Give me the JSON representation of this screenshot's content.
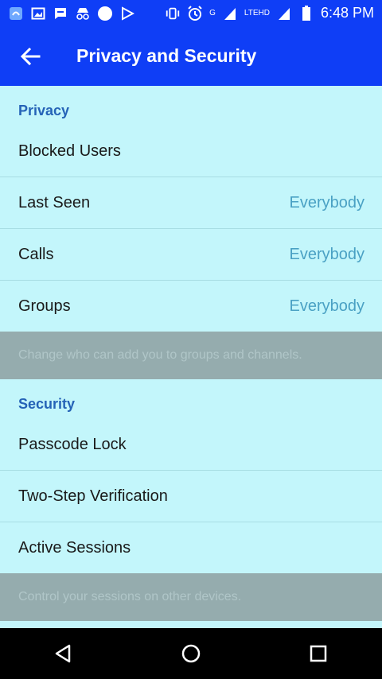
{
  "status_bar": {
    "time": "6:48 PM",
    "network_label": "G",
    "lte_label": "LTEHD",
    "icons": [
      "app-icon",
      "gallery-icon",
      "message-icon",
      "incognito-icon",
      "circle-icon",
      "play-store-icon",
      "vibrate-icon",
      "alarm-icon",
      "signal-icon",
      "signal-icon",
      "battery-icon"
    ]
  },
  "app_bar": {
    "title": "Privacy and Security",
    "back_icon": "back-arrow-icon"
  },
  "privacy": {
    "header": "Privacy",
    "items": [
      {
        "label": "Blocked Users",
        "value": ""
      },
      {
        "label": "Last Seen",
        "value": "Everybody"
      },
      {
        "label": "Calls",
        "value": "Everybody"
      },
      {
        "label": "Groups",
        "value": "Everybody"
      }
    ],
    "info": "Change who can add you to groups and channels."
  },
  "security": {
    "header": "Security",
    "items": [
      {
        "label": "Passcode Lock"
      },
      {
        "label": "Two-Step Verification"
      },
      {
        "label": "Active Sessions"
      }
    ],
    "info": "Control your sessions on other devices."
  },
  "nav_bar": {
    "icons": [
      "back-triangle-icon",
      "home-circle-icon",
      "recents-square-icon"
    ]
  },
  "colors": {
    "app_bar": "#0f3ef6",
    "background": "#c3f6fb",
    "section_header": "#2563b7",
    "value": "#4aa1c4",
    "info_bg": "#95acae"
  }
}
